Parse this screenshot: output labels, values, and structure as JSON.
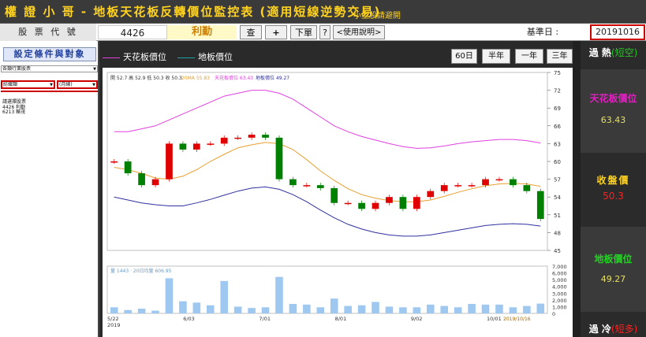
{
  "title": {
    "main": "權 證 小 哥 - 地板天花板反轉價位監控表 (適用短線逆勢交易)",
    "sub": "小型股請避開"
  },
  "toolbar": {
    "code_label": "股 票 代 號",
    "code_value": "4426",
    "stock_name": "利勤",
    "query_label": "查",
    "add_label": "+",
    "order_label": "下單",
    "help_label": "?",
    "manual_label": "<使用說明>",
    "base_date_label": "基準日 :",
    "base_date": "20191016"
  },
  "left_panel": {
    "settings_label": "設定條件與對象",
    "category_value": "各類行業股票",
    "group_value": "紡織類",
    "period_value": "(月線)",
    "list_title": "請選擇股票",
    "list_items": [
      "4426 利勤",
      "6213 聯茂"
    ]
  },
  "legend": {
    "ceiling": "天花板價位",
    "floor": "地板價位"
  },
  "period_buttons": [
    "60日",
    "半年",
    "一年",
    "三年"
  ],
  "right_panel": {
    "hot_label": "過 熱",
    "hot_tag": "(短空)",
    "ceiling_label": "天花板價位",
    "ceiling_value": "63.43",
    "close_label": "收盤價",
    "close_value": "50.3",
    "floor_label": "地板價位",
    "floor_value": "49.27",
    "cold_label": "過 冷",
    "cold_tag": "(短多)"
  },
  "colors": {
    "ceiling_line": "#e040e0",
    "floor_line": "#3030a0",
    "ma_line": "#e8a030",
    "up_candle": "#e00000",
    "down_candle": "#008000",
    "volume_bar": "#9ec8f0"
  },
  "chart_data": {
    "type": "line",
    "price_info": "開 52.7  高 52.9  低 50.3  收 50.3",
    "ma_label": "20MA 55.83",
    "ceiling_label": "天花板價位 63.43",
    "floor_label": "地板價位 49.27",
    "volume_label": "量 1443 · 20日均量 606.95",
    "x_ticks": [
      "5/22\n2019",
      "6/03",
      "7/01",
      "8/01",
      "9/02",
      "10/01"
    ],
    "last_date": "2019/10/16",
    "y_price_ticks": [
      75,
      72,
      69,
      66,
      63,
      60,
      57,
      54,
      51,
      48,
      45
    ],
    "y_volume_ticks": [
      "7,000",
      "6,000",
      "5,000",
      "4,000",
      "3,000",
      "2,000",
      "1,000",
      "0"
    ],
    "ylim_price": [
      45,
      75
    ],
    "ylim_volume": [
      0,
      7000
    ],
    "ceiling_series": [
      65,
      65,
      65.5,
      66,
      67,
      68,
      69,
      70,
      71,
      71.5,
      72,
      72,
      71.5,
      70.5,
      69,
      67.5,
      66,
      65,
      64.2,
      63.6,
      63,
      62.5,
      62.2,
      62.3,
      62.6,
      63,
      63.3,
      63.5,
      63.7,
      63.7,
      63.5,
      63.1
    ],
    "floor_series": [
      54,
      53.5,
      53,
      52.7,
      52.5,
      52.5,
      53,
      53.6,
      54.3,
      55,
      55.5,
      55.7,
      55.3,
      54.4,
      53.2,
      51.8,
      50.5,
      49.4,
      48.6,
      48,
      47.6,
      47.4,
      47.4,
      47.6,
      48,
      48.4,
      48.8,
      49.2,
      49.4,
      49.5,
      49.4,
      49.1
    ],
    "ma_series": [
      59,
      58.6,
      58,
      57.2,
      57,
      57.5,
      58.6,
      60,
      61.2,
      62.3,
      62.8,
      63.2,
      63,
      62,
      60.3,
      58.4,
      56.8,
      55.4,
      54.4,
      53.8,
      53.4,
      53.2,
      53.2,
      53.5,
      54.1,
      54.8,
      55.4,
      55.9,
      56.2,
      56.3,
      56.2,
      55.8
    ],
    "close_series": [
      60,
      58,
      56,
      57,
      63,
      62,
      63,
      63,
      64,
      64,
      64.5,
      64,
      57,
      56,
      56,
      55.5,
      53,
      53,
      52,
      53,
      54,
      52,
      54,
      55,
      56,
      56,
      56,
      57,
      57,
      56,
      55,
      50.3
    ],
    "volume_series": [
      900,
      500,
      700,
      400,
      5200,
      1800,
      1600,
      1200,
      4800,
      1000,
      800,
      900,
      5400,
      1400,
      1300,
      900,
      2200,
      1100,
      1200,
      1700,
      1000,
      900,
      900,
      1300,
      1100,
      900,
      1400,
      1300,
      1300,
      900,
      1100,
      1443
    ]
  }
}
